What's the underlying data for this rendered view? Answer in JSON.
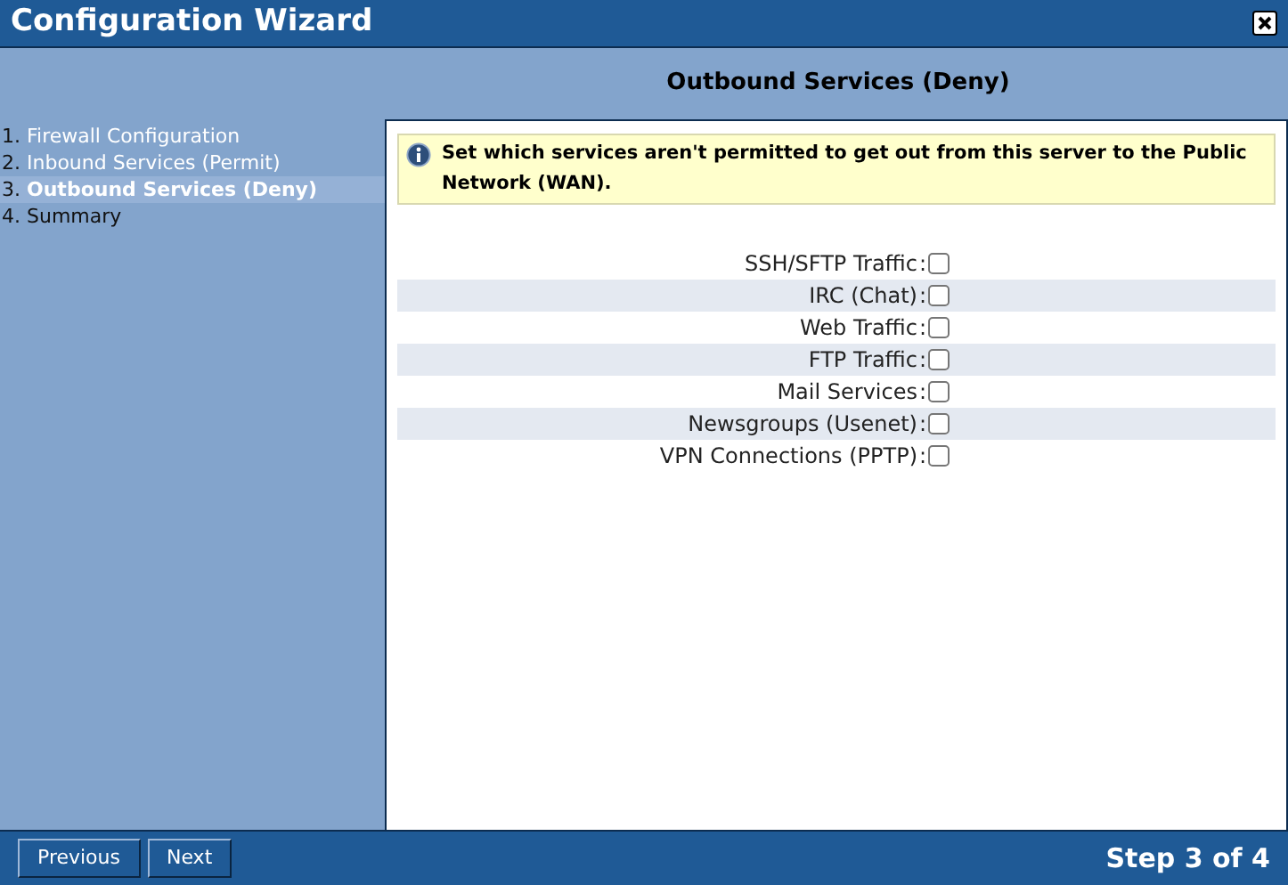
{
  "window": {
    "title": "Configuration Wizard"
  },
  "page_title": "Outbound Services (Deny)",
  "steps": [
    {
      "number": "1.",
      "label": "Firewall Configuration",
      "selected": false,
      "completed": true
    },
    {
      "number": "2.",
      "label": "Inbound Services (Permit)",
      "selected": false,
      "completed": true
    },
    {
      "number": "3.",
      "label": "Outbound Services (Deny)",
      "selected": true,
      "completed": false
    },
    {
      "number": "4.",
      "label": "Summary",
      "selected": false,
      "completed": false
    }
  ],
  "info": "Set which services aren't permitted to get out from this server to the Public Network (WAN).",
  "services": [
    {
      "label": "SSH/SFTP Traffic",
      "checked": false
    },
    {
      "label": "IRC (Chat)",
      "checked": false
    },
    {
      "label": "Web Traffic",
      "checked": false
    },
    {
      "label": "FTP Traffic",
      "checked": false
    },
    {
      "label": "Mail Services",
      "checked": false
    },
    {
      "label": "Newsgroups (Usenet)",
      "checked": false
    },
    {
      "label": "VPN Connections (PPTP)",
      "checked": false
    }
  ],
  "separator": ":",
  "buttons": [
    "Previous",
    "Next"
  ],
  "step_indicator": "Step 3 of 4"
}
